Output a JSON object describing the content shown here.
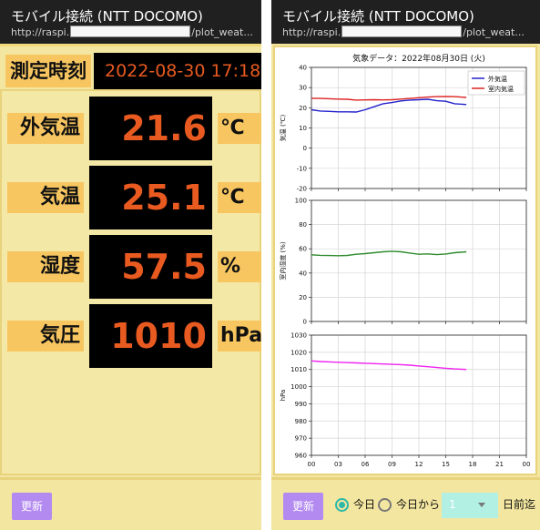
{
  "left": {
    "title": "モバイル接続 (NTT DOCOMO)",
    "url_prefix": "http://raspi.",
    "url_suffix": "/plot_weat...",
    "time_label": "測定時刻",
    "time_value": "2022-08-30 17:18",
    "readings": [
      {
        "label": "外気温",
        "value": "21.6",
        "unit": "℃"
      },
      {
        "label": "気温",
        "value": "25.1",
        "unit": "℃"
      },
      {
        "label": "湿度",
        "value": "57.5",
        "unit": "%"
      },
      {
        "label": "気圧",
        "value": "1010",
        "unit": "hPa"
      }
    ],
    "update_button": "更新"
  },
  "right": {
    "title": "モバイル接続 (NTT DOCOMO)",
    "url_prefix": "http://raspi.",
    "url_suffix": "/plot_weat...",
    "update_button": "更新",
    "radio_today": "今日",
    "radio_from_today": "今日から",
    "days_select_value": "1",
    "days_suffix": "日前迄"
  },
  "chart_data": [
    {
      "type": "line",
      "title": "気象データ：2022年08月30日 (火)",
      "ylabel": "気温 (℃)",
      "ylim": [
        -20,
        40
      ],
      "yticks": [
        -20,
        -10,
        0,
        10,
        20,
        30,
        40
      ],
      "xlim": [
        0,
        24
      ],
      "xticks": [
        "00",
        "03",
        "06",
        "09",
        "12",
        "15",
        "18",
        "21",
        "00"
      ],
      "grid": true,
      "legend": "top-right",
      "series": [
        {
          "name": "外気温",
          "color": "#2222cc",
          "x": [
            0,
            1,
            2,
            3,
            4,
            5,
            6,
            7,
            8,
            9,
            10,
            11,
            12,
            13,
            14,
            15,
            16,
            17.3
          ],
          "values": [
            19,
            18.4,
            18.2,
            18,
            18,
            17.9,
            19,
            20.5,
            22,
            22.6,
            23.4,
            23.8,
            24,
            24.2,
            23.5,
            23.2,
            22,
            21.6
          ]
        },
        {
          "name": "室内気温",
          "color": "#dd2222",
          "x": [
            0,
            1,
            2,
            3,
            4,
            5,
            6,
            7,
            8,
            9,
            10,
            11,
            12,
            13,
            14,
            15,
            16,
            17.3
          ],
          "values": [
            24.7,
            24.6,
            24.5,
            24.3,
            24.2,
            23.8,
            23.9,
            24,
            23.9,
            24,
            24.3,
            24.6,
            25,
            25.3,
            25.5,
            25.6,
            25.5,
            25.1
          ]
        }
      ]
    },
    {
      "type": "line",
      "ylabel": "室内湿度 (%)",
      "ylim": [
        0,
        100
      ],
      "yticks": [
        0,
        20,
        40,
        60,
        80,
        100
      ],
      "xlim": [
        0,
        24
      ],
      "grid": true,
      "series": [
        {
          "color": "#2e8b2e",
          "x": [
            0,
            1,
            2,
            3,
            4,
            5,
            6,
            7,
            8,
            9,
            10,
            11,
            12,
            13,
            14,
            15,
            16,
            17.3
          ],
          "values": [
            55,
            54.6,
            54.4,
            54.3,
            54.5,
            55.5,
            56,
            56.8,
            57.5,
            58,
            57.5,
            56.5,
            55.5,
            55.8,
            55.2,
            55.7,
            56.8,
            57.5
          ]
        }
      ]
    },
    {
      "type": "line",
      "ylabel": "hPa",
      "ylim": [
        960,
        1030
      ],
      "yticks": [
        960,
        970,
        980,
        990,
        1000,
        1010,
        1020,
        1030
      ],
      "xlim": [
        0,
        24
      ],
      "grid": true,
      "series": [
        {
          "color": "#ee22ee",
          "x": [
            0,
            1,
            2,
            3,
            4,
            5,
            6,
            7,
            8,
            9,
            10,
            11,
            12,
            13,
            14,
            15,
            16,
            17.3
          ],
          "values": [
            1015,
            1014.6,
            1014.4,
            1014.2,
            1014,
            1013.8,
            1013.6,
            1013.4,
            1013.2,
            1013,
            1012.8,
            1012.5,
            1012,
            1011.6,
            1011.1,
            1010.7,
            1010.3,
            1010
          ]
        }
      ]
    }
  ]
}
